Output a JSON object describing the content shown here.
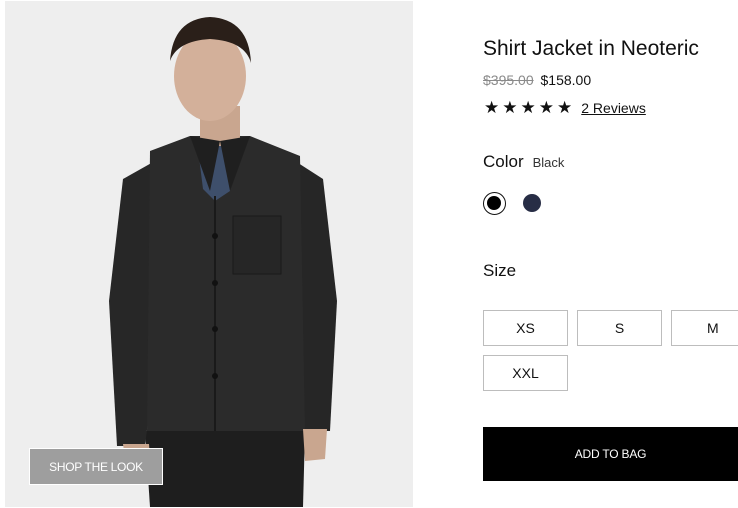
{
  "product": {
    "title": "Shirt Jacket in Neoteric",
    "price_original": "$395.00",
    "price_sale": "$158.00",
    "rating": 5,
    "stars": [
      "★",
      "★",
      "★",
      "★",
      "★"
    ],
    "reviews_label": "2 Reviews"
  },
  "image": {
    "shop_the_look_label": "SHOP THE LOOK"
  },
  "color": {
    "label": "Color",
    "selected": "Black",
    "swatches": [
      {
        "name": "Black",
        "hex": "#000000"
      },
      {
        "name": "Navy",
        "hex": "#272d45"
      }
    ]
  },
  "size": {
    "label": "Size",
    "options": [
      "XS",
      "S",
      "M",
      "XXL"
    ]
  },
  "actions": {
    "add_to_bag_label": "ADD TO BAG"
  }
}
